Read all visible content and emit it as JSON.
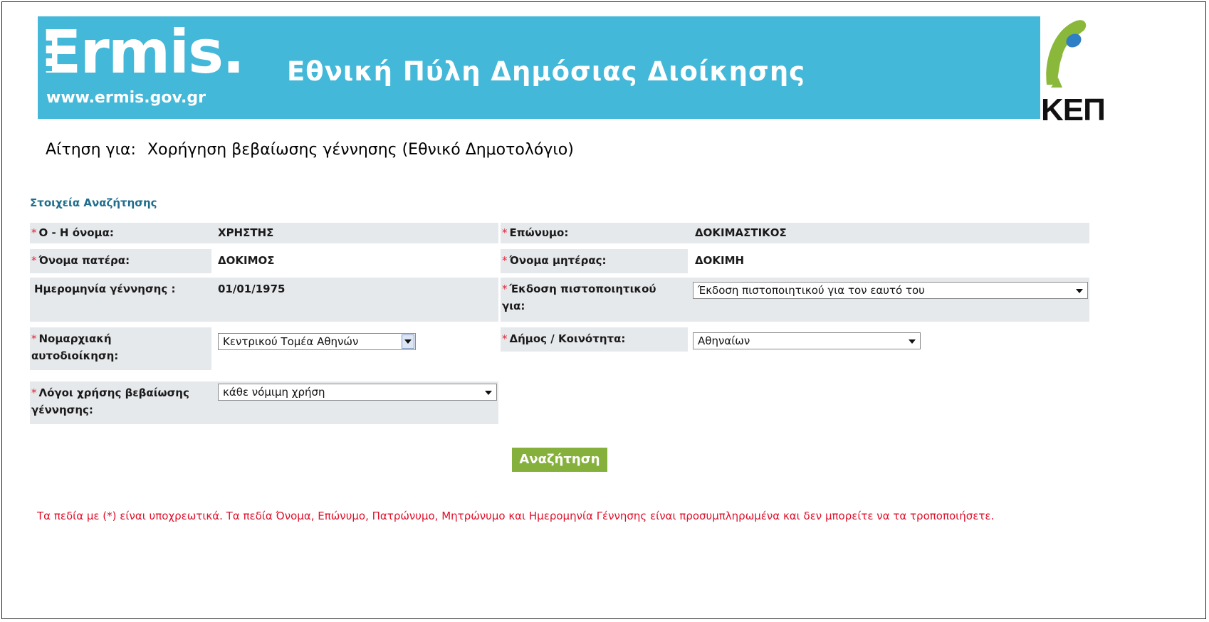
{
  "header": {
    "logo_text": "Ermis.",
    "logo_url": "www.ermis.gov.gr",
    "portal_title": "Εθνική Πύλη Δημόσιας Διοίκησης",
    "kep_text": "ΚΕΠ"
  },
  "request": {
    "label": "Αίτηση για:",
    "service": "Χορήγηση βεβαίωσης γέννησης (Εθνικό Δημοτολόγιο)"
  },
  "section_title": "Στοιχεία Αναζήτησης",
  "required_mark": "*",
  "form": {
    "first_name": {
      "label": "Ο - Η όνομα:",
      "value": "ΧΡΗΣΤΗΣ",
      "required": true
    },
    "surname": {
      "label": "Επώνυμο:",
      "value": "ΔΟΚΙΜΑΣΤΙΚΟΣ",
      "required": true
    },
    "father_name": {
      "label": "Όνομα πατέρα:",
      "value": "ΔΟΚΙΜΟΣ",
      "required": true
    },
    "mother_name": {
      "label": "Όνομα μητέρας:",
      "value": "ΔΟΚΙΜΗ",
      "required": true
    },
    "birth_date": {
      "label": "Ημερομηνία γέννησης :",
      "value": "01/01/1975",
      "required": false
    },
    "certificate_for": {
      "label": "Έκδοση πιστοποιητικού για:",
      "selected": "Έκδοση πιστοποιητικού για τον εαυτό του",
      "required": true
    },
    "prefecture": {
      "label": "Νομαρχιακή αυτοδιοίκηση:",
      "selected": "Κεντρικού Τομέα Αθηνών",
      "required": true
    },
    "municipality": {
      "label": "Δήμος / Κοινότητα:",
      "selected": "Αθηναίων",
      "required": true
    },
    "usage_reason": {
      "label": "Λόγοι χρήσης βεβαίωσης γέννησης:",
      "selected": "κάθε νόμιμη χρήση",
      "required": true
    }
  },
  "search_button": "Αναζήτηση",
  "note": "Τα πεδία με (*) είναι υποχρεωτικά. Τα πεδία Όνομα, Επώνυμο, Πατρώνυμο, Μητρώνυμο και Ημερομηνία Γέννησης είναι προσυμπληρωμένα και δεν μπορείτε να τα τροποποιήσετε.",
  "colors": {
    "banner": "#43b8d9",
    "button": "#86b03c",
    "section_title": "#1f6e8c",
    "note": "#e0102a",
    "label_bg": "#e6e9ec",
    "kep_green": "#8ab83a"
  }
}
